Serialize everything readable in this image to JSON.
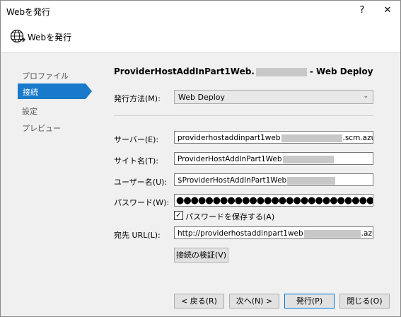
{
  "window": {
    "title": "Webを発行",
    "help_glyph": "?",
    "close_glyph": "✕"
  },
  "header": {
    "title": "Webを発行",
    "icon": "globe-publish-icon"
  },
  "nav": {
    "items": [
      {
        "label": "プロファイル"
      },
      {
        "label": "接続"
      },
      {
        "label": "設定"
      },
      {
        "label": "プレビュー"
      }
    ],
    "selected_index": 1
  },
  "profile": {
    "name_prefix": "ProviderHostAddInPart1Web.",
    "name_suffix": "- Web Deploy"
  },
  "form": {
    "method": {
      "label": "発行方法(M):",
      "value": "Web Deploy"
    },
    "server": {
      "label": "サーバー(E):",
      "prefix": "providerhostaddinpart1web",
      "suffix": ".scm.azurewebsites.ne"
    },
    "site": {
      "label": "サイト名(T):",
      "prefix": "ProviderHostAddInPart1Web"
    },
    "user": {
      "label": "ユーザー名(U):",
      "prefix": "$ProviderHostAddInPart1Web"
    },
    "password": {
      "label": "パスワード(W):",
      "mask": "●●●●●●●●●●●●●●●●●●●●●●●●●●●●●●●●"
    },
    "save_password": {
      "label": "パスワードを保存する(A)",
      "checked": true
    },
    "dest_url": {
      "label": "宛先 URL(L):",
      "prefix": "http://providerhostaddinpart1web",
      "suffix": ".azurewebsites."
    },
    "validate_button": "接続の検証(V)"
  },
  "footer": {
    "back": "< 戻る(R)",
    "next": "次へ(N) >",
    "publish": "発行(P)",
    "close": "閉じる(O)"
  }
}
